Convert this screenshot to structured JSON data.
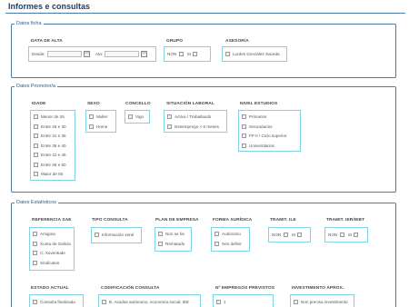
{
  "page": {
    "title": "Informes e consultas"
  },
  "ficha": {
    "legend": "Datos ficha",
    "data_alta": {
      "title": "DATA DE ALTA",
      "desde_label": "Desde:",
      "ata_label": "Ata:"
    },
    "grupo": {
      "title": "GRUPO",
      "non": "NON",
      "si": "SI"
    },
    "asesor": {
      "title": "ASESOR/A",
      "option": "Lurdes Gonzalez Saceda"
    }
  },
  "promotor": {
    "legend": "Datos Promotor/a",
    "idade": {
      "title": "IDADE",
      "options": [
        "Menor de 26",
        "Entre 26 e 30",
        "Entre 31 e 35",
        "Entre 36 e 40",
        "Entre 41 e 45",
        "Entre 46 e 50",
        "Maior de 50"
      ]
    },
    "sexo": {
      "title": "SEXO",
      "options": [
        "Muller",
        "Home"
      ]
    },
    "concello": {
      "title": "CONCELLO",
      "options": [
        "Vigo"
      ]
    },
    "situacion": {
      "title": "SITUACIÓN LABORAL",
      "options": [
        "Activa / Traballando",
        "Desemprego < 6 meses"
      ]
    },
    "estudios": {
      "title": "NIVEL ESTUDIOS",
      "options": [
        "Primarios",
        "Secundarios",
        "FP II / Ciclo superior",
        "Universitarios"
      ]
    }
  },
  "estatisticos": {
    "legend": "Datos Estatísticos",
    "referencia": {
      "title": "REFERENCIA SAE",
      "options": [
        "Amigo/a",
        "Xunta de Galicia",
        "C. Xuventude",
        "Sindicatos"
      ]
    },
    "tipo": {
      "title": "TIPO CONSULTA",
      "options": [
        "Información xeral"
      ]
    },
    "plan": {
      "title": "PLAN DE EMPRESA",
      "options": [
        "Non se fai",
        "Rematado"
      ]
    },
    "forma": {
      "title": "FORMA XURÍDICA",
      "options": [
        "Autónomo",
        "Sen definir"
      ]
    },
    "tramit_ile": {
      "title": "TRAMIT. ILE",
      "non": "NON",
      "si": "SI"
    },
    "tramit_ier": {
      "title": "TRAMIT. IER/IEBT",
      "non": "NON",
      "si": "SI"
    },
    "estado": {
      "title": "ESTADO ACTUAL",
      "options": [
        "Consulta finalizada"
      ]
    },
    "codificacion": {
      "title": "CODIFICACIÓN CONSULTA",
      "options": [
        "B. Axudas autónomo, economía social, IEE"
      ]
    },
    "empregos": {
      "title": "Nº EMPREGOS PREVISTOS",
      "options": [
        "1"
      ]
    },
    "investimento": {
      "title": "INVESTIMENTO APROX.",
      "options": [
        "Non precisa investimento"
      ]
    }
  }
}
